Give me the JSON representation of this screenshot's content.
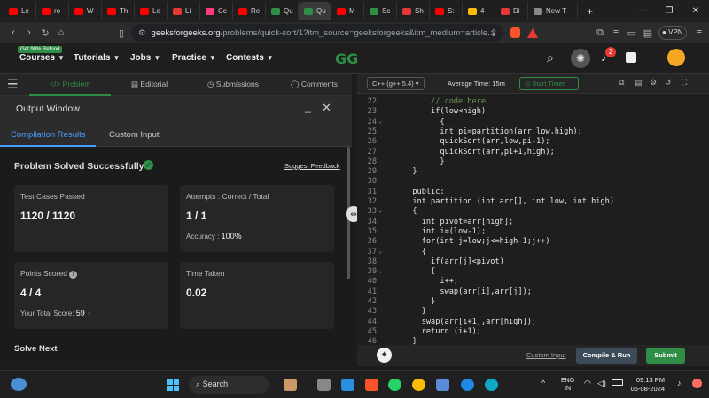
{
  "browser": {
    "tabs": [
      {
        "label": "Le",
        "color": "#ff0000"
      },
      {
        "label": "ro",
        "color": "#ff0000"
      },
      {
        "label": "W",
        "color": "#ff0000"
      },
      {
        "label": "Th",
        "color": "#ff0000"
      },
      {
        "label": "Le",
        "color": "#ff0000"
      },
      {
        "label": "Li",
        "color": "#e53935"
      },
      {
        "label": "Cc",
        "color": "#ff3b7a"
      },
      {
        "label": "Re",
        "color": "#ff0000"
      },
      {
        "label": "Qu",
        "color": "#2f8d46"
      },
      {
        "label": "Qu",
        "color": "#2f8d46",
        "active": true
      },
      {
        "label": "M",
        "color": "#ff0000"
      },
      {
        "label": "Sc",
        "color": "#2f8d46"
      },
      {
        "label": "Sh",
        "color": "#e53935"
      },
      {
        "label": "S:",
        "color": "#ff0000"
      },
      {
        "label": "4 |",
        "color": "#fbbc05"
      },
      {
        "label": "Di",
        "color": "#e53935"
      },
      {
        "label": "New T",
        "color": "#888888"
      }
    ],
    "new_tab": "+",
    "url_main": "geeksforgeeks.org",
    "url_rest": "/problems/quick-sort/1?itm_source=geeksforgeeks&itm_medium=article...",
    "vpn_label": "VPN"
  },
  "header": {
    "refund_badge": "Get 90% Refund",
    "menus": [
      "Courses",
      "Tutorials",
      "Jobs",
      "Practice",
      "Contests"
    ],
    "logo": "GG",
    "notification_count": "2"
  },
  "problem_tabs": {
    "problem": "Problem",
    "editorial": "Editorial",
    "submissions": "Submissions",
    "comments": "Comments"
  },
  "output": {
    "title": "Output Window",
    "tab_results": "Compilation Results",
    "tab_custom": "Custom Input",
    "status": "Problem Solved Successfully",
    "suggest": "Suggest Feedback",
    "cards": {
      "tests_label": "Test Cases Passed",
      "tests_value": "1120 / 1120",
      "attempts_label": "Attempts : Correct / Total",
      "attempts_value": "1 / 1",
      "accuracy_label": "Accuracy :",
      "accuracy_value": "100%",
      "points_label": "Points Scored",
      "points_value": "4 / 4",
      "total_label": "Your Total Score:",
      "total_value": "59",
      "time_label": "Time Taken",
      "time_value": "0.02"
    },
    "solve_next": "Solve Next"
  },
  "editor": {
    "language": "C++ (g++ 5.4)",
    "avg_time": "Average Time: 15m",
    "start_timer": "Start Timer",
    "lines": [
      {
        "n": "22",
        "t": "      // code here",
        "c": "#6a9955"
      },
      {
        "n": "23",
        "t": "      if(low<high)"
      },
      {
        "n": "24",
        "t": "        {",
        "f": true
      },
      {
        "n": "25",
        "t": "        int pi=partition(arr,low,high);"
      },
      {
        "n": "26",
        "t": "        quickSort(arr,low,pi-1);"
      },
      {
        "n": "27",
        "t": "        quickSort(arr,pi+1,high);"
      },
      {
        "n": "28",
        "t": "        }"
      },
      {
        "n": "29",
        "t": "  }"
      },
      {
        "n": "30",
        "t": ""
      },
      {
        "n": "31",
        "t": "  public:"
      },
      {
        "n": "32",
        "t": "  int partition (int arr[], int low, int high)"
      },
      {
        "n": "33",
        "t": "  {",
        "f": true
      },
      {
        "n": "34",
        "t": "    int pivot=arr[high];"
      },
      {
        "n": "35",
        "t": "    int i=(low-1);"
      },
      {
        "n": "36",
        "t": "    for(int j=low;j<=high-1;j++)"
      },
      {
        "n": "37",
        "t": "    {",
        "f": true
      },
      {
        "n": "38",
        "t": "      if(arr[j]<pivot)"
      },
      {
        "n": "39",
        "t": "      {",
        "f": true
      },
      {
        "n": "40",
        "t": "        i++;"
      },
      {
        "n": "41",
        "t": "        swap(arr[i],arr[j]);"
      },
      {
        "n": "42",
        "t": "      }"
      },
      {
        "n": "43",
        "t": "    }"
      },
      {
        "n": "44",
        "t": "    swap(arr[i+1],arr[high]);"
      },
      {
        "n": "45",
        "t": "    return (i+1);"
      },
      {
        "n": "46",
        "t": "  }"
      }
    ],
    "custom_input": "Custom Input",
    "compile_run": "Compile & Run",
    "submit": "Submit"
  },
  "taskbar": {
    "search": "Search",
    "lang_top": "ENG",
    "lang_bottom": "IN",
    "time": "09:13 PM",
    "date": "06-08-2024"
  },
  "colors": {
    "accent": "#2f8d46",
    "submit": "#2f8d46",
    "compile": "#3d4a57"
  }
}
